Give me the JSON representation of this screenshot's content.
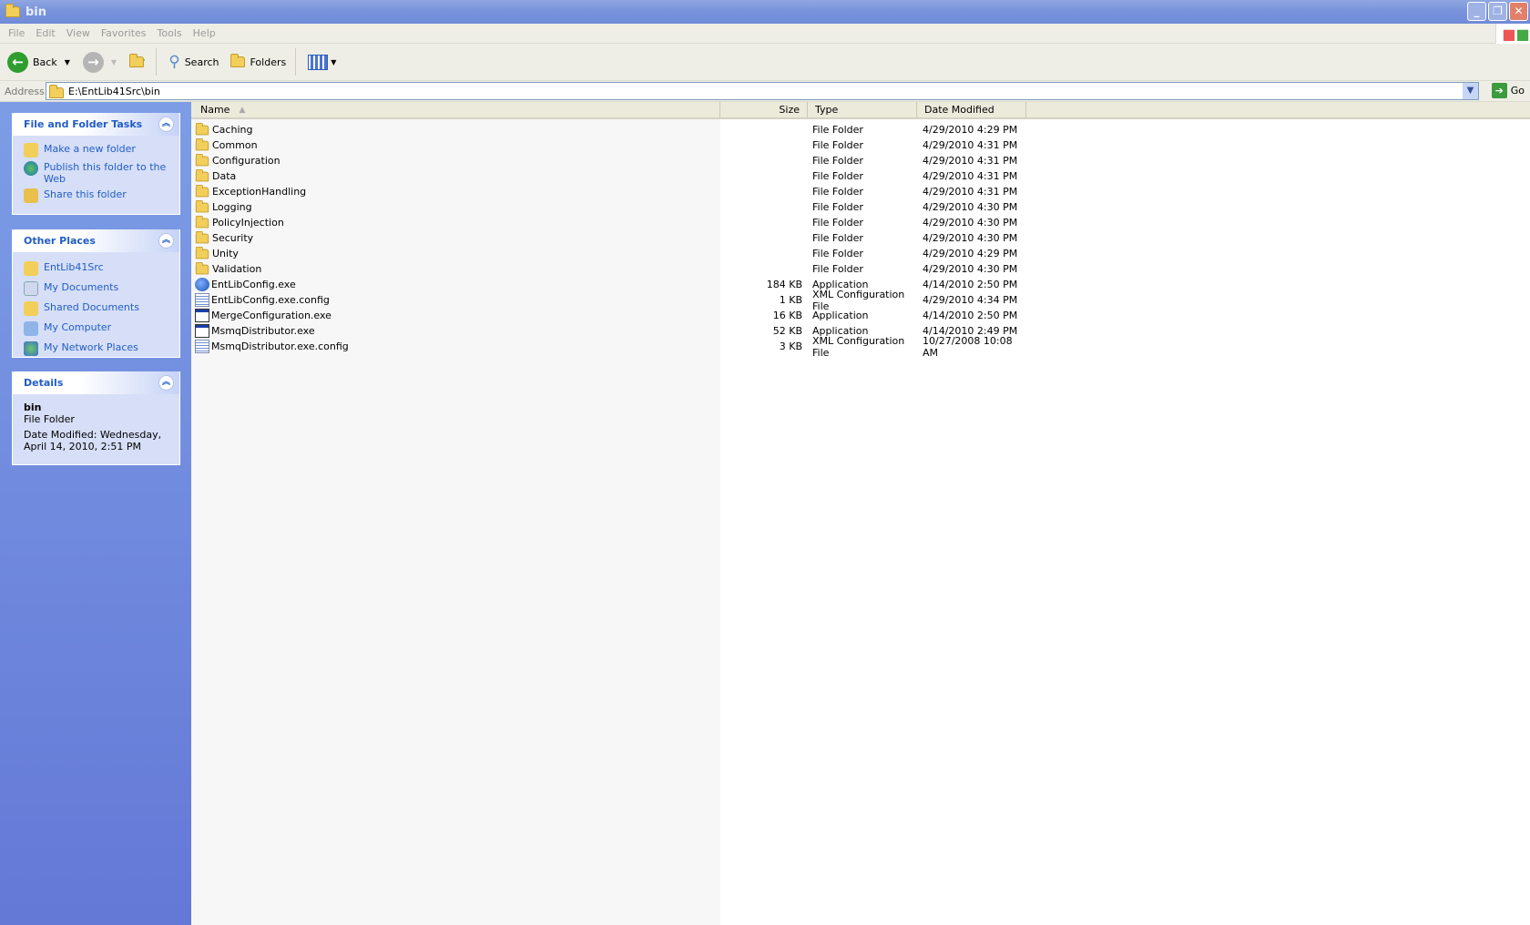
{
  "window": {
    "title": "bin",
    "buttons": [
      "minimize",
      "restore",
      "close"
    ]
  },
  "menu": [
    "File",
    "Edit",
    "View",
    "Favorites",
    "Tools",
    "Help"
  ],
  "toolbar": {
    "back": "Back",
    "search": "Search",
    "folders": "Folders"
  },
  "address": {
    "label": "Address",
    "value": "E:\\EntLib41Src\\bin",
    "go": "Go"
  },
  "tasks": {
    "title": "File and Folder Tasks",
    "items": [
      "Make a new folder",
      "Publish this folder to the Web",
      "Share this folder"
    ]
  },
  "places": {
    "title": "Other Places",
    "items": [
      "EntLib41Src",
      "My Documents",
      "Shared Documents",
      "My Computer",
      "My Network Places"
    ]
  },
  "details": {
    "title": "Details",
    "name": "bin",
    "type": "File Folder",
    "modified": "Date Modified: Wednesday, April 14, 2010, 2:51 PM"
  },
  "columns": {
    "name": "Name",
    "size": "Size",
    "type": "Type",
    "date": "Date Modified"
  },
  "files": [
    {
      "name": "Caching",
      "size": "",
      "type": "File Folder",
      "date": "4/29/2010 4:29 PM",
      "icon": "folder"
    },
    {
      "name": "Common",
      "size": "",
      "type": "File Folder",
      "date": "4/29/2010 4:31 PM",
      "icon": "folder"
    },
    {
      "name": "Configuration",
      "size": "",
      "type": "File Folder",
      "date": "4/29/2010 4:31 PM",
      "icon": "folder"
    },
    {
      "name": "Data",
      "size": "",
      "type": "File Folder",
      "date": "4/29/2010 4:31 PM",
      "icon": "folder"
    },
    {
      "name": "ExceptionHandling",
      "size": "",
      "type": "File Folder",
      "date": "4/29/2010 4:31 PM",
      "icon": "folder"
    },
    {
      "name": "Logging",
      "size": "",
      "type": "File Folder",
      "date": "4/29/2010 4:30 PM",
      "icon": "folder"
    },
    {
      "name": "PolicyInjection",
      "size": "",
      "type": "File Folder",
      "date": "4/29/2010 4:30 PM",
      "icon": "folder"
    },
    {
      "name": "Security",
      "size": "",
      "type": "File Folder",
      "date": "4/29/2010 4:30 PM",
      "icon": "folder"
    },
    {
      "name": "Unity",
      "size": "",
      "type": "File Folder",
      "date": "4/29/2010 4:29 PM",
      "icon": "folder"
    },
    {
      "name": "Validation",
      "size": "",
      "type": "File Folder",
      "date": "4/29/2010 4:30 PM",
      "icon": "folder"
    },
    {
      "name": "EntLibConfig.exe",
      "size": "184 KB",
      "type": "Application",
      "date": "4/14/2010 2:50 PM",
      "icon": "globe"
    },
    {
      "name": "EntLibConfig.exe.config",
      "size": "1 KB",
      "type": "XML Configuration File",
      "date": "4/29/2010 4:34 PM",
      "icon": "cfg"
    },
    {
      "name": "MergeConfiguration.exe",
      "size": "16 KB",
      "type": "Application",
      "date": "4/14/2010 2:50 PM",
      "icon": "app"
    },
    {
      "name": "MsmqDistributor.exe",
      "size": "52 KB",
      "type": "Application",
      "date": "4/14/2010 2:49 PM",
      "icon": "app"
    },
    {
      "name": "MsmqDistributor.exe.config",
      "size": "3 KB",
      "type": "XML Configuration File",
      "date": "10/27/2008 10:08 AM",
      "icon": "cfg"
    }
  ]
}
